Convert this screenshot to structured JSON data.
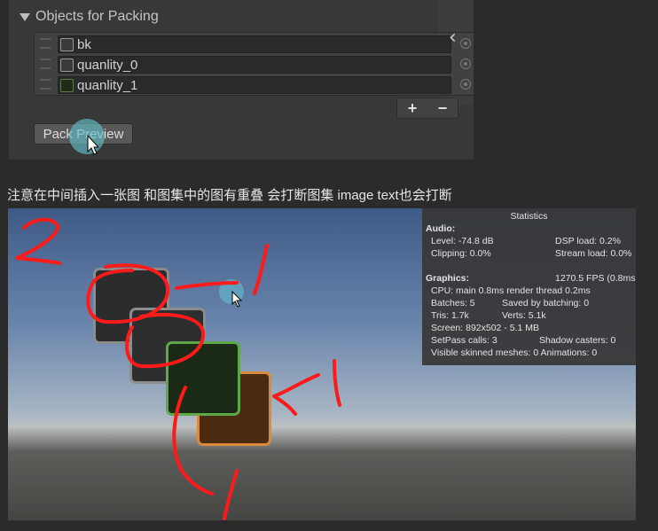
{
  "inspector": {
    "title": "Objects for Packing",
    "items": [
      {
        "label": "bk"
      },
      {
        "label": "quanlity_0"
      },
      {
        "label": "quanlity_1"
      }
    ],
    "plus_label": "+",
    "minus_label": "−",
    "chevron": "‹",
    "pack_preview_label": "Pack Preview"
  },
  "caption": "注意在中间插入一张图 和图集中的图有重叠 会打断图集 image text也会打断",
  "stats": {
    "title": "Statistics",
    "audio_header": "Audio:",
    "level": "Level: -74.8 dB",
    "dsp_load": "DSP load: 0.2%",
    "clipping": "Clipping: 0.0%",
    "stream_load": "Stream load: 0.0%",
    "graphics_header": "Graphics:",
    "fps": "1270.5 FPS (0.8ms",
    "cpu": "CPU: main 0.8ms  render thread 0.2ms",
    "batches": "Batches: 5",
    "saved_batching": "Saved by batching: 0",
    "tris": "Tris: 1.7k",
    "verts": "Verts: 5.1k",
    "screen": "Screen: 892x502 - 5.1 MB",
    "setpass": "SetPass calls: 3",
    "shadow_casters": "Shadow casters: 0",
    "skinned": "Visible skinned meshes: 0  Animations: 0"
  },
  "annotations": [
    "2",
    "1",
    "1",
    "1"
  ],
  "colors": {
    "accent_click": "#64bec8",
    "annotation_red": "#ff1a1a",
    "tile_green_border": "#5fa84a",
    "tile_orange_border": "#d88a3a"
  }
}
